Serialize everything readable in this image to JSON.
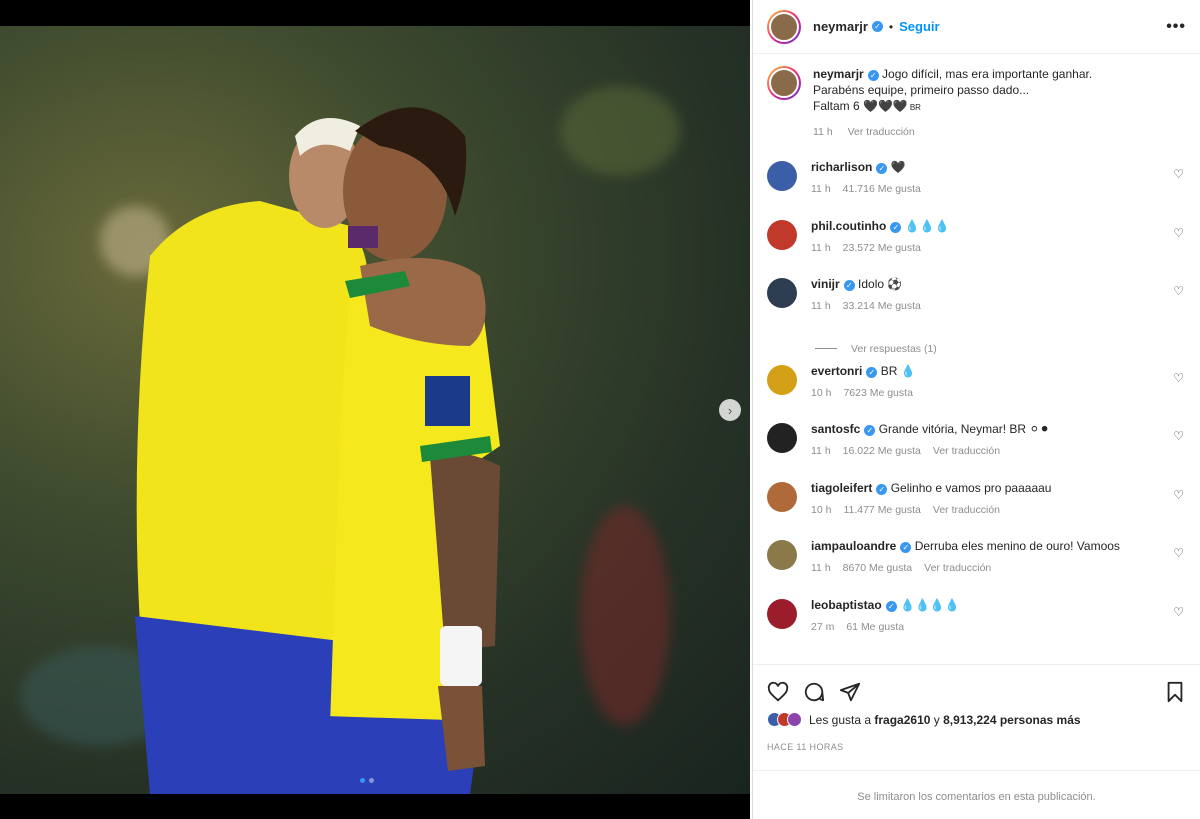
{
  "post": {
    "username": "neymarjr",
    "follow_label": "Seguir",
    "more_label": "•••",
    "dot": "•"
  },
  "caption": {
    "username": "neymarjr",
    "text_line1": "Jogo difícil, mas era importante ganhar.",
    "text_line2": "Parabéns equipe, primeiro passo dado...",
    "text_line3": "Faltam 6 🖤🖤🖤",
    "flag_text": "BR",
    "time": "11 h",
    "translate": "Ver traducción"
  },
  "comments": [
    {
      "username": "richarlison",
      "text": "🖤",
      "time": "11 h",
      "likes": "41.716 Me gusta",
      "translate": "",
      "avatar_color": "#3a5fa8"
    },
    {
      "username": "phil.coutinho",
      "text": "💧💧💧",
      "time": "11 h",
      "likes": "23.572 Me gusta",
      "translate": "",
      "avatar_color": "#c0392b"
    },
    {
      "username": "vinijr",
      "text": "Idolo ⚽",
      "time": "11 h",
      "likes": "33.214 Me gusta",
      "translate": "",
      "avatar_color": "#2c3e50"
    },
    {
      "username": "evertonri",
      "text": "BR 💧",
      "time": "10 h",
      "likes": "7623 Me gusta",
      "translate": "",
      "avatar_color": "#d4a017"
    },
    {
      "username": "santosfc",
      "text": "Grande vitória, Neymar! BR ⚪⚫",
      "time": "11 h",
      "likes": "16.022 Me gusta",
      "translate": "Ver traducción",
      "avatar_color": "#222222"
    },
    {
      "username": "tiagoleifert",
      "text": "Gelinho e vamos pro paaaaau",
      "time": "10 h",
      "likes": "11.477 Me gusta",
      "translate": "Ver traducción",
      "avatar_color": "#b06a3a"
    },
    {
      "username": "iampauloandre",
      "text": "Derruba eles menino de ouro! Vamoos",
      "time": "11 h",
      "likes": "8670 Me gusta",
      "translate": "Ver traducción",
      "avatar_color": "#8a7a4a"
    },
    {
      "username": "leobaptistao",
      "text": "💧💧💧💧",
      "time": "27 m",
      "likes": "61 Me gusta",
      "translate": "",
      "avatar_color": "#9b1c2a"
    }
  ],
  "replies_label": "Ver respuestas (1)",
  "likes": {
    "prefix": "Les gusta a",
    "user": "fraga2610",
    "mid": "y",
    "count": "8,913,224 personas más"
  },
  "timestamp": "HACE 11 HORAS",
  "limited_notice": "Se limitaron los comentarios en esta publicación.",
  "colors": {
    "accent": "#0095f6",
    "verified": "#3897f0",
    "muted": "#8e8e8e"
  },
  "icons": [
    "heart-icon",
    "comment-icon",
    "share-icon",
    "bookmark-icon",
    "chevron-right-icon",
    "more-icon"
  ]
}
